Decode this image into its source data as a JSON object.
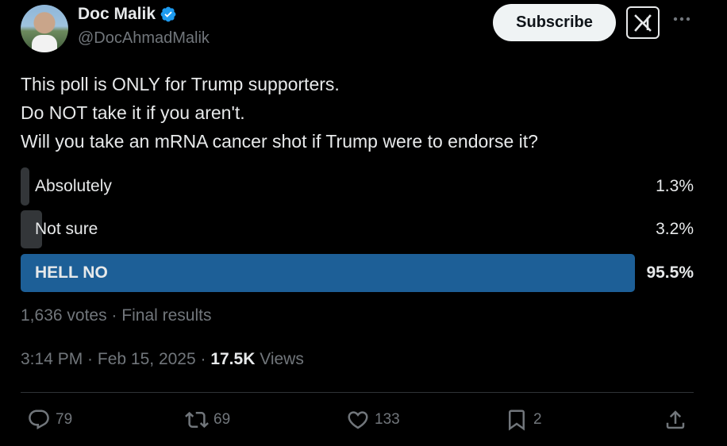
{
  "author": {
    "display_name": "Doc Malik",
    "handle": "@DocAhmadMalik",
    "verified": true,
    "verified_color": "#1d9bf0"
  },
  "header": {
    "subscribe_label": "Subscribe",
    "grok_icon": "grok-icon",
    "more_icon": "more-icon"
  },
  "tweet": {
    "lines": [
      "This poll is ONLY for Trump supporters.",
      "Do NOT take it if you aren't.",
      "Will you take an mRNA cancer shot if Trump were to endorse it?"
    ]
  },
  "poll": {
    "options": [
      {
        "label": "Absolutely",
        "percent_text": "1.3%",
        "percent": 1.3,
        "winner": false
      },
      {
        "label": "Not sure",
        "percent_text": "3.2%",
        "percent": 3.2,
        "winner": false
      },
      {
        "label": "HELL NO",
        "percent_text": "95.5%",
        "percent": 95.5,
        "winner": true
      }
    ],
    "votes": "1,636 votes",
    "separator": " · ",
    "status": "Final results",
    "bar_color": "#333639",
    "winner_color": "#1d5f97"
  },
  "meta": {
    "time": "3:14 PM",
    "separator": " · ",
    "date": "Feb 15, 2025",
    "views_count": "17.5K",
    "views_label": " Views"
  },
  "actions": {
    "replies": "79",
    "reposts": "69",
    "likes": "133",
    "bookmarks": "2"
  }
}
